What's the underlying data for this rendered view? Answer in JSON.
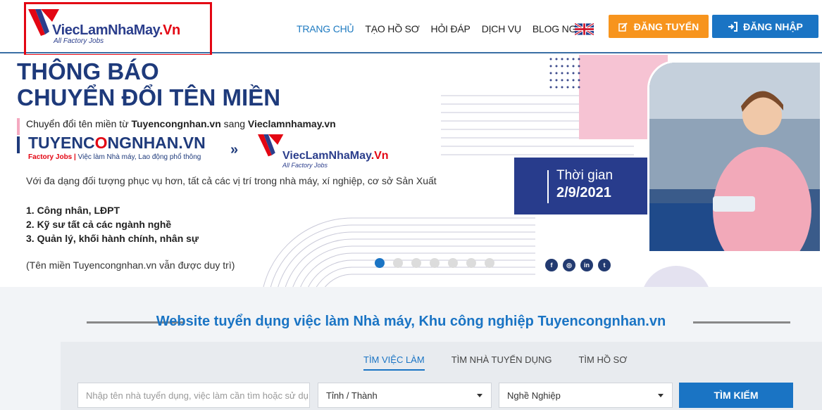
{
  "header": {
    "logo": {
      "name": "ViecLamNhaMay",
      "suffix": ".Vn",
      "tagline": "All Factory Jobs"
    },
    "nav": [
      "TRANG CHỦ",
      "TẠO HỒ SƠ",
      "HỎI ĐÁP",
      "DỊCH VỤ",
      "BLOG NGHỀ"
    ],
    "language_icon": "uk-flag-icon",
    "post_job_label": "ĐĂNG TUYỂN",
    "login_label": "ĐĂNG NHẬP"
  },
  "banner": {
    "title_line1": "THÔNG BÁO",
    "title_line2": "CHUYỂN ĐỔI TÊN MIỀN",
    "intro_prefix": "Chuyển đổi tên miền từ ",
    "intro_old": "Tuyencongnhan.vn",
    "intro_mid": " sang ",
    "intro_new": "Vieclamnhamay.vn",
    "old_logo": {
      "part1": "TUYENC",
      "part2": "O",
      "part3": "NGNHAN.VN",
      "sub_left": "Factory Jobs",
      "sub_right": "Việc làm Nhà máy, Lao động phổ thông"
    },
    "arrows": "»",
    "new_logo": {
      "name": "ViecLamNhaMay",
      "suffix": ".Vn",
      "tagline": "All Factory Jobs"
    },
    "description": "Với đa dạng đối tượng phục vụ hơn, tất cả các vị trí trong nhà máy, xí nghiệp, cơ sở Sản Xuất",
    "list": [
      "1. Công nhân, LĐPT",
      "2. Kỹ sư tất cả các ngành nghề",
      "3. Quản lý, khối hành chính, nhân sự"
    ],
    "note": "(Tên miền Tuyencongnhan.vn vẫn được duy trì)",
    "date_label": "Thời gian",
    "date_value": "2/9/2021",
    "slide_count": 7,
    "active_slide": 1,
    "social": [
      "facebook-icon",
      "instagram-icon",
      "linkedin-icon",
      "twitter-icon"
    ]
  },
  "search": {
    "title": "Website tuyển dụng việc làm Nhà máy, Khu công nghiệp Tuyencongnhan.vn",
    "tabs": [
      "TÌM VIỆC LÀM",
      "TÌM NHÀ TUYỂN DỤNG",
      "TÌM HỒ SƠ"
    ],
    "keyword_placeholder": "Nhập tên nhà tuyển dụng, việc làm cần tìm hoặc sử dụ",
    "province_value": "Tỉnh / Thành",
    "career_value": "Nghề Nghiệp",
    "search_button": "TÌM KIẾM"
  },
  "colors": {
    "brand_navy": "#1e3a7b",
    "accent_blue": "#1a74c4",
    "accent_orange": "#f7941d",
    "brand_red": "#e30613"
  }
}
